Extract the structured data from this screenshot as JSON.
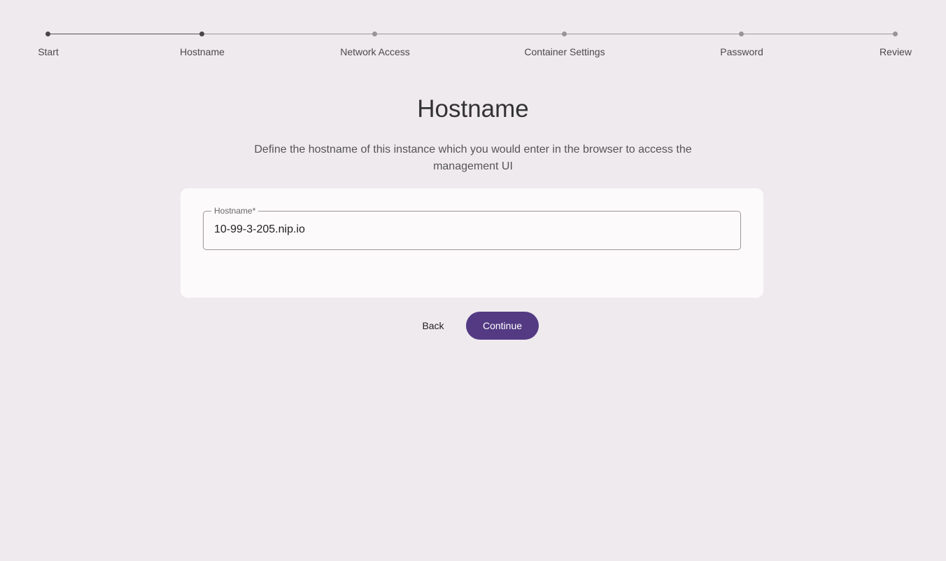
{
  "stepper": {
    "steps": [
      {
        "label": "Start",
        "state": "done"
      },
      {
        "label": "Hostname",
        "state": "current"
      },
      {
        "label": "Network Access",
        "state": "todo"
      },
      {
        "label": "Container Settings",
        "state": "todo"
      },
      {
        "label": "Password",
        "state": "todo"
      },
      {
        "label": "Review",
        "state": "todo"
      }
    ]
  },
  "page": {
    "title": "Hostname",
    "description": "Define the hostname of this instance which you would enter in the browser to access the management UI"
  },
  "form": {
    "hostname_label": "Hostname*",
    "hostname_value": "10-99-3-205.nip.io"
  },
  "actions": {
    "back_label": "Back",
    "continue_label": "Continue"
  },
  "colors": {
    "background": "#efeaee",
    "card": "#fdfafc",
    "primary": "#533a83"
  }
}
